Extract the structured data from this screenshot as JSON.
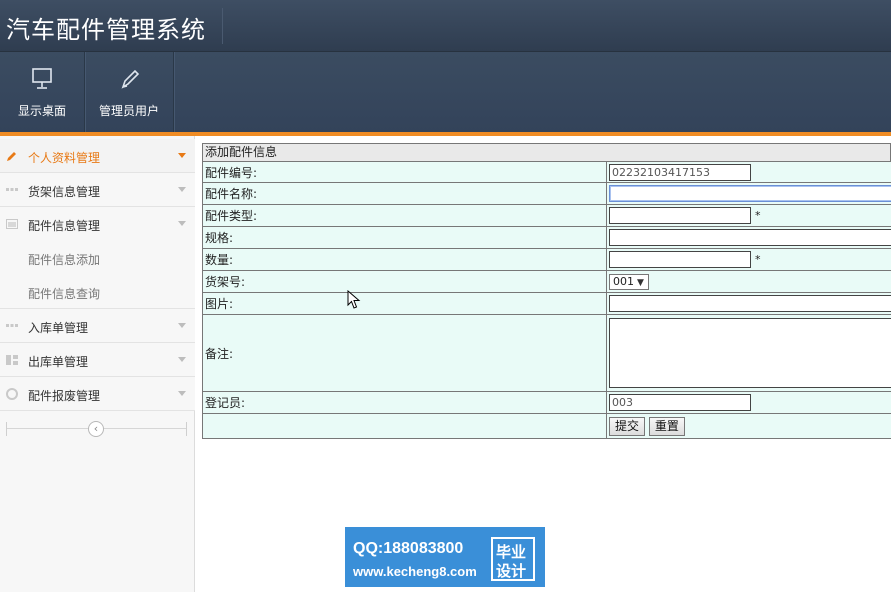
{
  "app": {
    "title": "汽车配件管理系统"
  },
  "toolbar": {
    "items": [
      {
        "label": "显示桌面",
        "icon": "monitor-icon"
      },
      {
        "label": "管理员用户",
        "icon": "pencil-icon"
      }
    ]
  },
  "sidebar": {
    "items": [
      {
        "label": "个人资料管理",
        "icon": "pencil-icon",
        "active": true
      },
      {
        "label": "货架信息管理",
        "icon": "grid-icon"
      },
      {
        "label": "配件信息管理",
        "icon": "window-icon"
      },
      {
        "label": "入库单管理",
        "icon": "grid-icon"
      },
      {
        "label": "出库单管理",
        "icon": "columns-icon"
      },
      {
        "label": "配件报废管理",
        "icon": "circle-icon"
      }
    ],
    "subitems": [
      {
        "label": "配件信息添加"
      },
      {
        "label": "配件信息查询"
      }
    ],
    "collapse_symbol": "‹"
  },
  "form": {
    "title": "添加配件信息",
    "fields": {
      "part_no": {
        "label": "配件编号:",
        "value": "02232103417153"
      },
      "part_name": {
        "label": "配件名称:",
        "value": ""
      },
      "part_type": {
        "label": "配件类型:",
        "value": "",
        "required_mark": "*"
      },
      "spec": {
        "label": "规格:",
        "value": ""
      },
      "quantity": {
        "label": "数量:",
        "value": "",
        "required_mark": "*"
      },
      "shelf_no": {
        "label": "货架号:",
        "value": "001"
      },
      "image": {
        "label": "图片:",
        "value": ""
      },
      "remark": {
        "label": "备注:",
        "value": ""
      },
      "registrar": {
        "label": "登记员:",
        "value": "003"
      }
    },
    "submit_label": "提交",
    "reset_label": "重置"
  },
  "watermark": {
    "qq": "QQ:188083800",
    "url": "www.kecheng8.com",
    "badge_line1": "毕业",
    "badge_line2": "设计"
  },
  "colors": {
    "header_bg": "#34445a",
    "accent": "#f08c24",
    "form_cell_bg": "#e9fbf7",
    "watermark_bg": "#3a8fd8"
  }
}
